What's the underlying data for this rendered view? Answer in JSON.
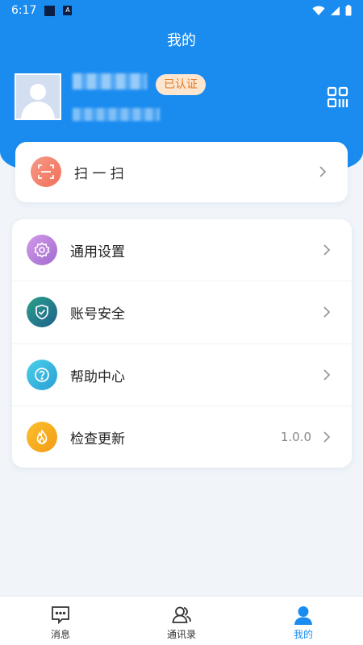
{
  "status_bar": {
    "time": "6:17"
  },
  "header": {
    "title": "我的"
  },
  "profile": {
    "verified_badge": "已认证"
  },
  "scan": {
    "label": "扫 一 扫"
  },
  "menu": {
    "items": [
      {
        "label": "通用设置",
        "icon": "settings-icon",
        "color": "#b57ad8"
      },
      {
        "label": "账号安全",
        "icon": "shield-icon",
        "color": "#1f7f7f"
      },
      {
        "label": "帮助中心",
        "icon": "help-icon",
        "color": "#2fb8d8"
      },
      {
        "label": "检查更新",
        "icon": "flame-icon",
        "color": "#f5a623",
        "value": "1.0.0"
      }
    ]
  },
  "bottom_nav": {
    "items": [
      {
        "label": "消息",
        "icon": "message-icon",
        "active": false
      },
      {
        "label": "通讯录",
        "icon": "contacts-icon",
        "active": false
      },
      {
        "label": "我的",
        "icon": "user-icon",
        "active": true
      }
    ]
  },
  "colors": {
    "primary": "#1a8cf0",
    "badge_bg": "#fde6cf",
    "badge_text": "#e07c2a",
    "page_bg": "#f1f5fa"
  }
}
